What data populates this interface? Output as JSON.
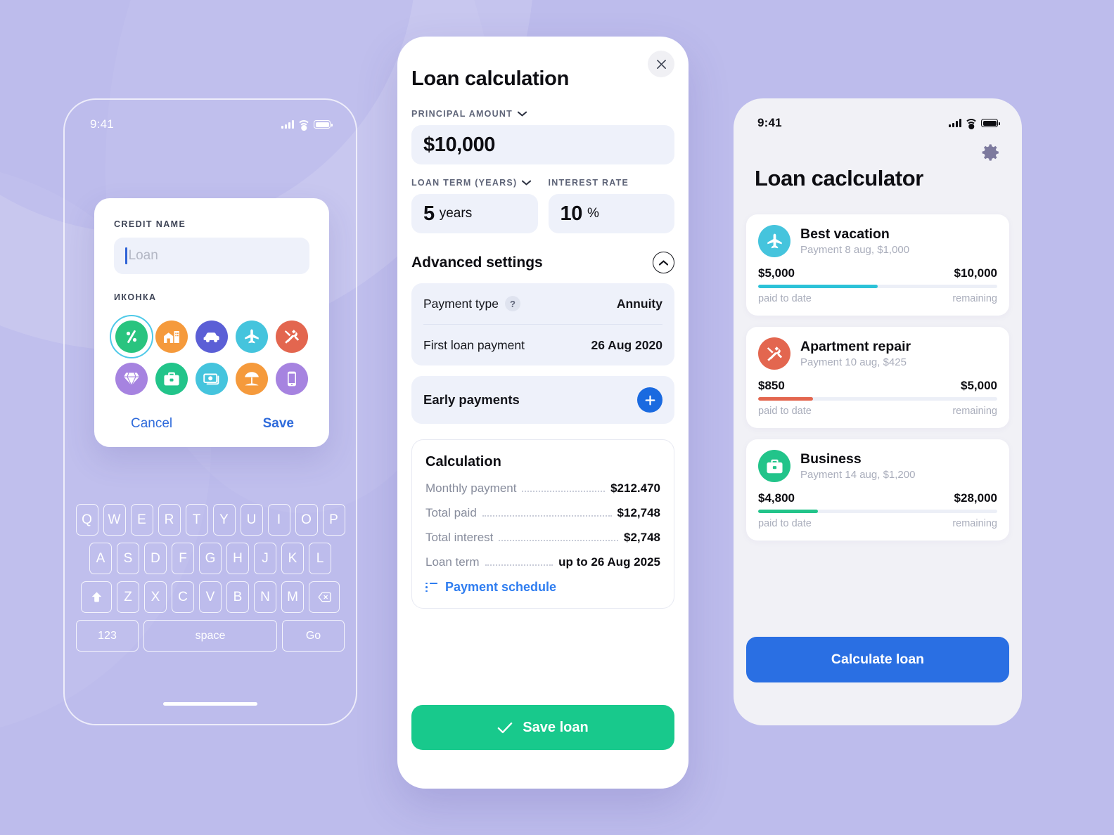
{
  "theme": {
    "background": "#bdbcec",
    "blue": "#2a6fe3",
    "link_blue": "#2f7df0",
    "green": "#18c98c",
    "panel": "#eef1fa"
  },
  "left_phone": {
    "status": {
      "time": "9:41",
      "icons": [
        "signal-icon",
        "wifi-icon",
        "battery-icon"
      ]
    },
    "modal": {
      "credit_name_label": "CREDIT NAME",
      "credit_name_value": "",
      "credit_name_placeholder": "Loan",
      "icon_label": "ИКОНКА",
      "icons": [
        {
          "name": "percent-icon",
          "color": "#29c47f",
          "selected": true
        },
        {
          "name": "building-icon",
          "color": "#f59a3c",
          "selected": false
        },
        {
          "name": "car-icon",
          "color": "#5b5fd6",
          "selected": false
        },
        {
          "name": "plane-icon",
          "color": "#45c4dd",
          "selected": false
        },
        {
          "name": "tools-icon",
          "color": "#e3664f",
          "selected": false
        },
        {
          "name": "diamond-icon",
          "color": "#a683e0",
          "selected": false
        },
        {
          "name": "briefcase-icon",
          "color": "#22c48a",
          "selected": false
        },
        {
          "name": "cash-icon",
          "color": "#45c4dd",
          "selected": false
        },
        {
          "name": "umbrella-icon",
          "color": "#f59a3c",
          "selected": false
        },
        {
          "name": "phone-icon",
          "color": "#a683e0",
          "selected": false
        }
      ],
      "cancel_label": "Cancel",
      "save_label": "Save"
    },
    "keyboard": {
      "row1": [
        "Q",
        "W",
        "E",
        "R",
        "T",
        "Y",
        "U",
        "I",
        "O",
        "P"
      ],
      "row2": [
        "A",
        "S",
        "D",
        "F",
        "G",
        "H",
        "J",
        "K",
        "L"
      ],
      "row3": [
        "Z",
        "X",
        "C",
        "V",
        "B",
        "N",
        "M"
      ],
      "shift_key": "shift-icon",
      "backspace_key": "backspace-icon",
      "numbers_key": "123",
      "space_key": "space",
      "go_key": "Go"
    }
  },
  "center_phone": {
    "close_icon": "close-icon",
    "title": "Loan calculation",
    "principal": {
      "label": "PRINCIPAL AMOUNT",
      "value": "$10,000",
      "has_dropdown": true
    },
    "term": {
      "label": "LOAN TERM (YEARS)",
      "value": "5",
      "unit": "years",
      "has_dropdown": true
    },
    "rate": {
      "label": "INTEREST RATE",
      "value": "10",
      "unit": "%",
      "has_dropdown": false
    },
    "advanced": {
      "title": "Advanced settings",
      "collapse_icon": "chevron-up-icon",
      "rows": [
        {
          "label": "Payment type",
          "value": "Annuity",
          "help": "?"
        },
        {
          "label": "First loan payment",
          "value": "26 Aug 2020"
        }
      ]
    },
    "early_payments": {
      "label": "Early payments",
      "add_icon": "plus-icon"
    },
    "calculation": {
      "title": "Calculation",
      "rows": [
        {
          "label": "Monthly payment",
          "value": "$212.470"
        },
        {
          "label": "Total paid",
          "value": "$12,748"
        },
        {
          "label": "Total interest",
          "value": "$2,748"
        },
        {
          "label": "Loan term",
          "value": "up to 26 Aug 2025"
        }
      ],
      "schedule_link": "Payment schedule",
      "schedule_icon": "list-icon"
    },
    "save_button": {
      "label": "Save loan",
      "icon": "check-icon"
    }
  },
  "right_phone": {
    "status": {
      "time": "9:41",
      "icons": [
        "signal-icon",
        "wifi-icon",
        "battery-icon"
      ]
    },
    "settings_icon": "gear-icon",
    "title": "Loan caclculator",
    "loans": [
      {
        "icon": "plane-icon",
        "icon_color": "#45c4dd",
        "name": "Best vacation",
        "subtitle": "Payment 8 aug, $1,000",
        "paid": "$5,000",
        "total": "$10,000",
        "paid_caption": "paid to date",
        "remaining_caption": "remaining",
        "progress_pct": 50,
        "bar_color": "#2cc2d8"
      },
      {
        "icon": "tools-icon",
        "icon_color": "#e3664f",
        "name": "Apartment repair",
        "subtitle": "Payment 10 aug, $425",
        "paid": "$850",
        "total": "$5,000",
        "paid_caption": "paid to date",
        "remaining_caption": "remaining",
        "progress_pct": 23,
        "bar_color": "#e3664f"
      },
      {
        "icon": "briefcase-icon",
        "icon_color": "#22c48a",
        "name": "Business",
        "subtitle": "Payment 14 aug, $1,200",
        "paid": "$4,800",
        "total": "$28,000",
        "paid_caption": "paid to date",
        "remaining_caption": "remaining",
        "progress_pct": 25,
        "bar_color": "#22c48a"
      }
    ],
    "calculate_button": {
      "label": "Calculate loan"
    }
  }
}
